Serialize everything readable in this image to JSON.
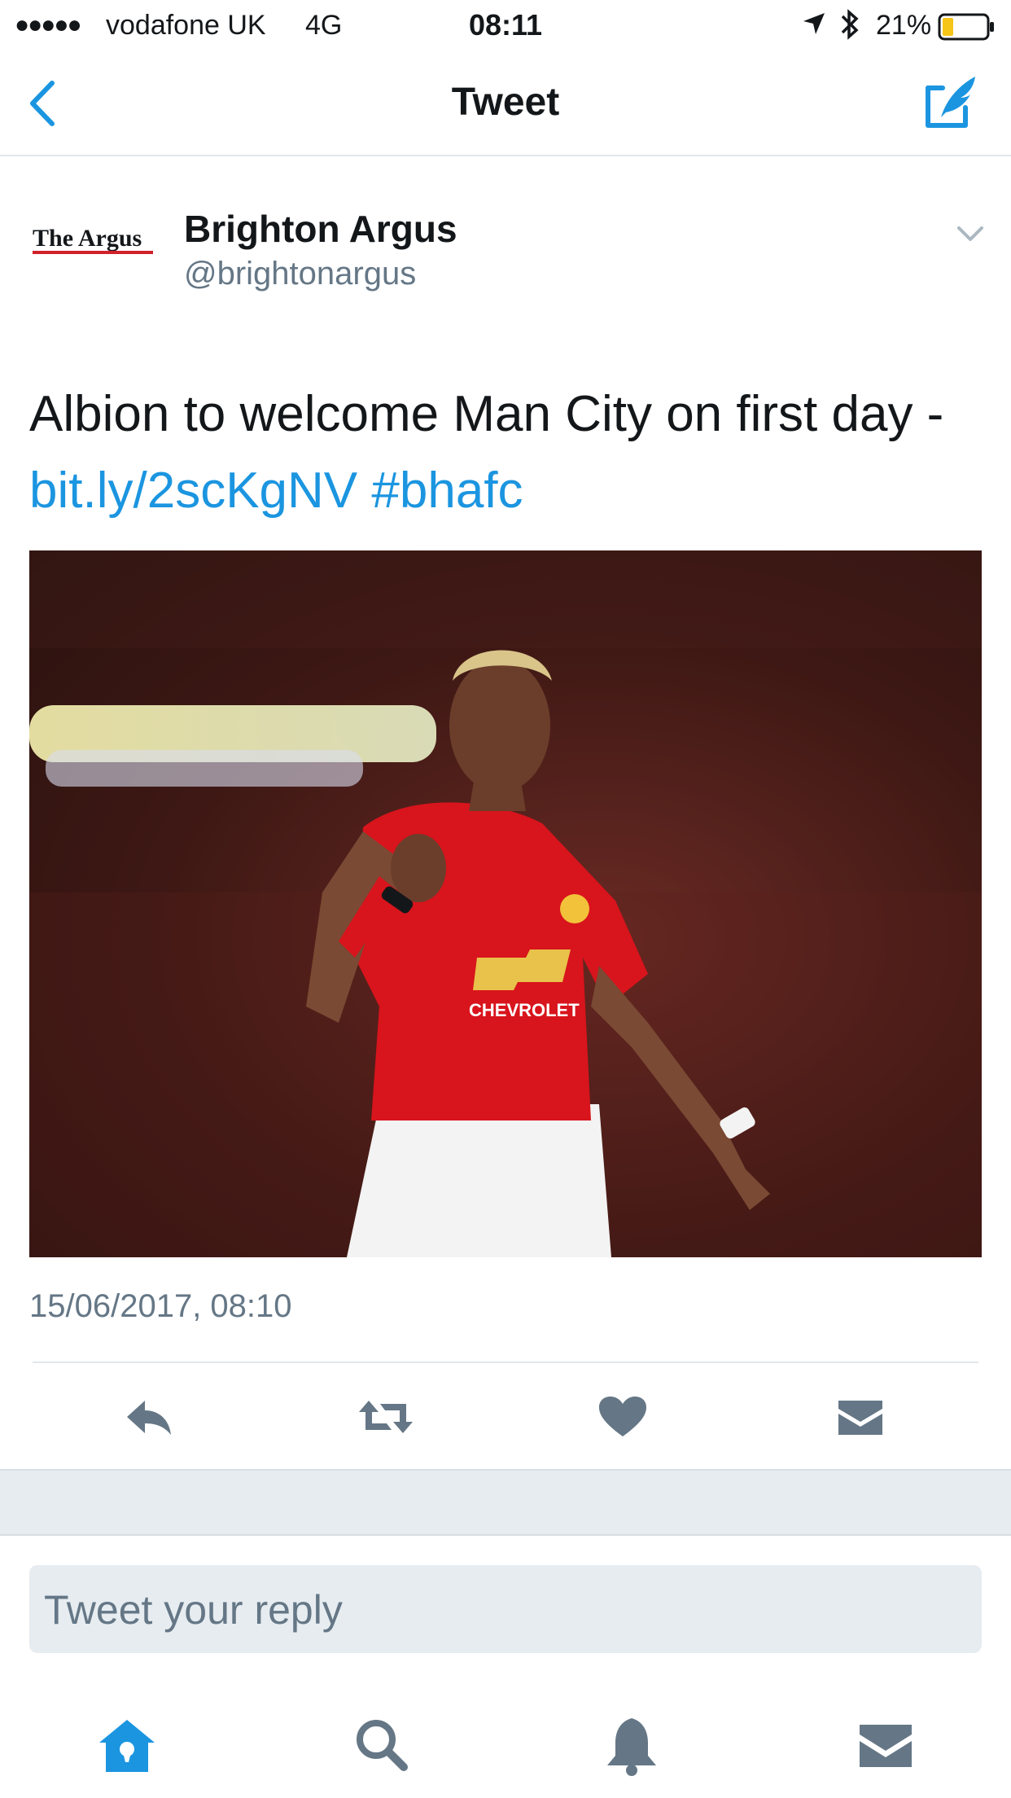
{
  "status_bar": {
    "signal": "●●●●●",
    "carrier": "vodafone UK",
    "network": "4G",
    "time": "08:11",
    "battery": "21%"
  },
  "nav": {
    "title": "Tweet",
    "back_icon": "chevron-left-icon",
    "compose_icon": "compose-tweet-icon"
  },
  "tweet": {
    "author_logo_text": "The Argus",
    "author_name": "Brighton Argus",
    "author_handle": "@brightonargus",
    "text": "Albion to welcome Man City on first day -",
    "link": "bit.ly/2scKgNV",
    "hashtag": "#bhafc",
    "media_sponsor_text": "CHEVROLET",
    "timestamp": "15/06/2017, 08:10"
  },
  "actions": {
    "reply_icon": "reply-icon",
    "retweet_icon": "retweet-icon",
    "like_icon": "heart-icon",
    "dm_icon": "envelope-icon"
  },
  "reply": {
    "placeholder": "Tweet your reply"
  },
  "tabs": [
    {
      "name": "Home",
      "icon": "home-icon"
    },
    {
      "name": "Search",
      "icon": "search-icon"
    },
    {
      "name": "Notifications",
      "icon": "bell-icon"
    },
    {
      "name": "Messages",
      "icon": "envelope-icon"
    }
  ],
  "colors": {
    "accent": "#1b95e0",
    "icon_gray": "#657786",
    "band": "#e6ecf0"
  }
}
